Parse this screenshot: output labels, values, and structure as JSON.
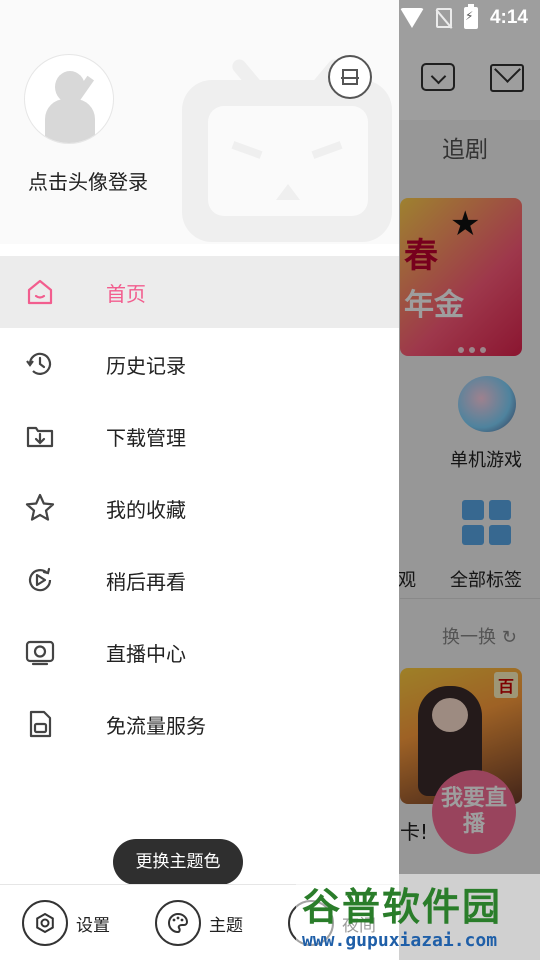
{
  "status_bar": {
    "time": "4:14"
  },
  "background": {
    "tab_label": "追剧",
    "game_label": "单机游戏",
    "partial_label": "观",
    "all_tags_label": "全部标签",
    "refresh_label": "换一换",
    "thumb_tag": "百",
    "caption_partial": "卡!",
    "fab_label": "我要直播",
    "banner_text1": "春",
    "banner_text2": "年金"
  },
  "drawer": {
    "login_prompt": "点击头像登录",
    "menu": [
      {
        "label": "首页",
        "icon": "home-icon",
        "active": true
      },
      {
        "label": "历史记录",
        "icon": "history-icon",
        "active": false
      },
      {
        "label": "下载管理",
        "icon": "download-icon",
        "active": false
      },
      {
        "label": "我的收藏",
        "icon": "star-icon",
        "active": false
      },
      {
        "label": "稍后再看",
        "icon": "watch-later-icon",
        "active": false
      },
      {
        "label": "直播中心",
        "icon": "live-icon",
        "active": false
      },
      {
        "label": "免流量服务",
        "icon": "free-data-icon",
        "active": false
      }
    ],
    "bottom": {
      "settings_label": "设置",
      "theme_label": "主题",
      "night_label": "夜间"
    },
    "tooltip": "更换主题色"
  },
  "watermark": {
    "title": "谷普软件园",
    "url": "www.gupuxiazai.com"
  },
  "colors": {
    "accent": "#f25d8e",
    "active_bg": "#ececec"
  }
}
